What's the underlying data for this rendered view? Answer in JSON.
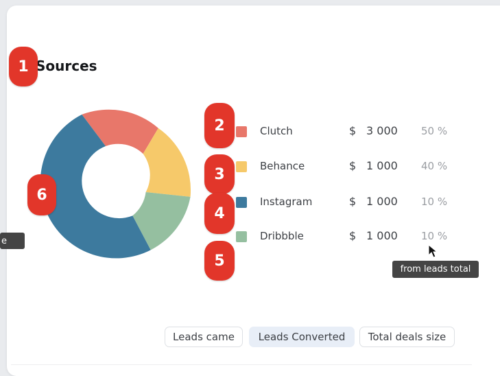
{
  "card": {
    "title": "Sources"
  },
  "markers": [
    "1",
    "2",
    "3",
    "4",
    "5",
    "6"
  ],
  "legend": [
    {
      "name": "Clutch",
      "currency": "$",
      "amount": "3 000",
      "percent": "50 %",
      "color": "#e8776a"
    },
    {
      "name": "Behance",
      "currency": "$",
      "amount": "1 000",
      "percent": "40 %",
      "color": "#f6c96a"
    },
    {
      "name": "Instagram",
      "currency": "$",
      "amount": "1 000",
      "percent": "10 %",
      "color": "#3d7a9e"
    },
    {
      "name": "Dribbble",
      "currency": "$",
      "amount": "1 000",
      "percent": "10 %",
      "color": "#95bfa0"
    }
  ],
  "donut_colors": {
    "clutch": "#e8776a",
    "behance": "#f6c96a",
    "dribbble": "#95bfa0",
    "instagram": "#3d7a9e"
  },
  "tooltips": {
    "percent_hint": "from leads total",
    "left_partial": "e"
  },
  "tabs": [
    {
      "label": "Leads came",
      "active": false
    },
    {
      "label": "Leads Converted",
      "active": true
    },
    {
      "label": "Total deals size",
      "active": false
    }
  ],
  "icons": [
    "mouse-cursor-icon"
  ]
}
